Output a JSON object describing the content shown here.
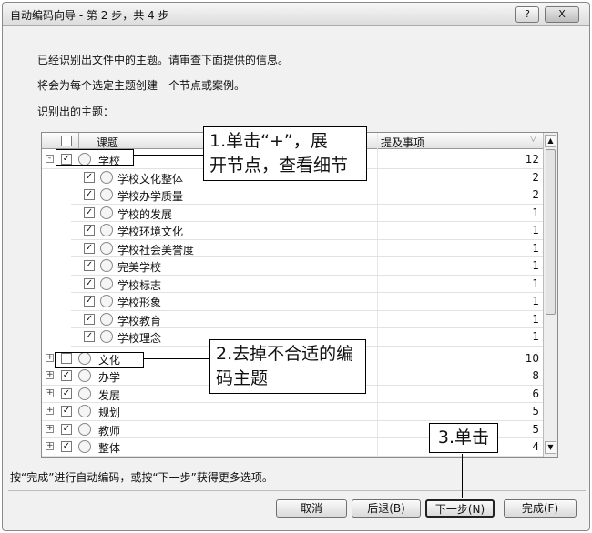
{
  "window": {
    "title": "自动编码向导 - 第 2 步，共 4 步",
    "help_label": "?",
    "close_label": "X"
  },
  "intro": {
    "line1": "已经识别出文件中的主题。请审查下面提供的信息。",
    "line2": "将会为每个选定主题创建一个节点或案例。",
    "line3": "识别出的主题："
  },
  "grid": {
    "col_topic": "课题",
    "col_mentions": "提及事项",
    "filter_icon": "funnel-icon",
    "parent": {
      "label": "学校",
      "count": "12",
      "checked": true
    },
    "children": [
      {
        "label": "学校文化整体",
        "count": "2"
      },
      {
        "label": "学校办学质量",
        "count": "2"
      },
      {
        "label": "学校的发展",
        "count": "1"
      },
      {
        "label": "学校环境文化",
        "count": "1"
      },
      {
        "label": "学校社会美誉度",
        "count": "1"
      },
      {
        "label": "完美学校",
        "count": "1"
      },
      {
        "label": "学校标志",
        "count": "1"
      },
      {
        "label": "学校形象",
        "count": "1"
      },
      {
        "label": "学校教育",
        "count": "1"
      },
      {
        "label": "学校理念",
        "count": "1"
      }
    ],
    "topics": [
      {
        "label": "文化",
        "count": "10",
        "checked": false
      },
      {
        "label": "办学",
        "count": "8",
        "checked": true
      },
      {
        "label": "发展",
        "count": "6",
        "checked": true
      },
      {
        "label": "规划",
        "count": "5",
        "checked": true
      },
      {
        "label": "教师",
        "count": "5",
        "checked": true
      },
      {
        "label": "整体",
        "count": "4",
        "checked": true
      }
    ]
  },
  "footer": {
    "hint": "按“完成”进行自动编码，或按“下一步”获得更多选项。"
  },
  "buttons": {
    "cancel": "取消",
    "back": "后退(B)",
    "next": "下一步(N)",
    "finish": "完成(F)"
  },
  "annotations": {
    "step1_line1": "1.单击“+”，展",
    "step1_line2": "开节点，查看细节",
    "step2_line1": "2.去掉不合适的编",
    "step2_line2": "码主题",
    "step3": "3.单击"
  }
}
